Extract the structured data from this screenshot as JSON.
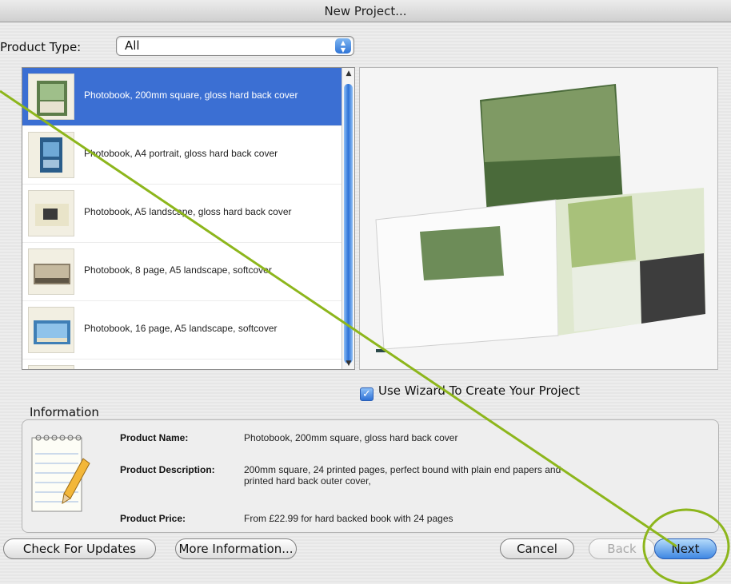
{
  "window": {
    "title": "New Project..."
  },
  "product_type": {
    "label": "Product Type:",
    "selected": "All"
  },
  "products": [
    {
      "label": "Photobook, 200mm square, gloss hard back cover",
      "selected": true
    },
    {
      "label": "Photobook, A4 portrait, gloss hard back cover",
      "selected": false
    },
    {
      "label": "Photobook, A5 landscape, gloss hard back cover",
      "selected": false
    },
    {
      "label": "Photobook, 8 page, A5 landscape, softcover",
      "selected": false
    },
    {
      "label": "Photobook, 16 page, A5 landscape, softcover",
      "selected": false
    }
  ],
  "wizard": {
    "label": "Use Wizard To Create Your Project",
    "checked": true
  },
  "information": {
    "title": "Information",
    "name_label": "Product Name:",
    "name_value": "Photobook, 200mm square, gloss hard back cover",
    "description_label": "Product Description:",
    "description_value": "200mm square, 24 printed pages, perfect bound with plain end papers and\nprinted hard back outer cover,",
    "price_label": "Product Price:",
    "price_value": "From £22.99 for hard backed book with 24 pages"
  },
  "buttons": {
    "check_updates": "Check For Updates",
    "more_info": "More Information...",
    "cancel": "Cancel",
    "back": "Back",
    "next": "Next"
  },
  "colors": {
    "selection": "#3b6fd3",
    "annotation": "#8db61c",
    "primary_button": "#3f87e3"
  }
}
